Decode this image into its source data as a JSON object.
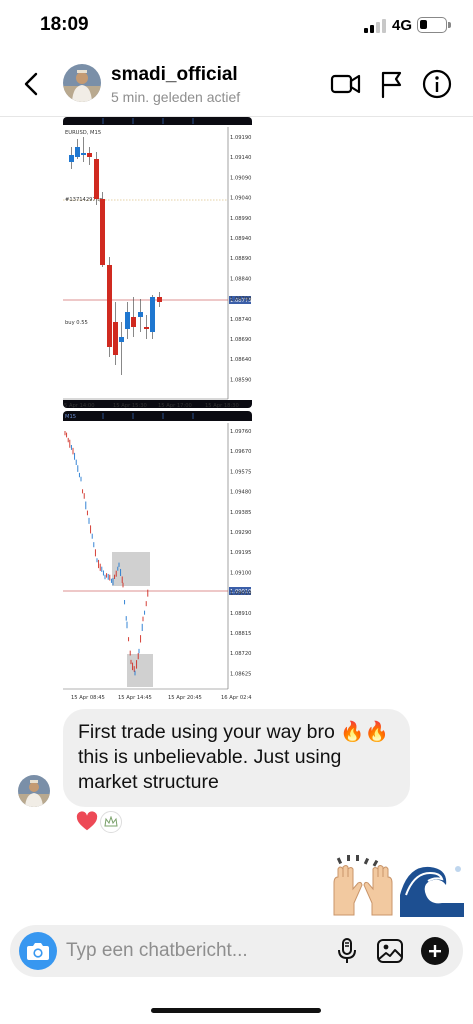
{
  "status_bar": {
    "time": "18:09",
    "network": "4G",
    "battery_level": 0.2
  },
  "header": {
    "username": "smadi_official",
    "activity": "5 min. geleden actief",
    "icons": [
      "back-chevron-icon",
      "video-call-icon",
      "flag-icon",
      "info-icon"
    ]
  },
  "chart1": {
    "symbol": "EURUSD, M15",
    "order_label": "#13714297 tp",
    "buy_label": "buy 0.55",
    "price_ticks": [
      "1.09190",
      "1.09140",
      "1.09090",
      "1.09040",
      "1.08990",
      "1.08940",
      "1.08890",
      "1.08840",
      "1.08790",
      "1.08740",
      "1.08690",
      "1.08640",
      "1.08590"
    ],
    "current_price": "1.08773",
    "time_ticks": [
      "5 Apr 14:00",
      "15 Apr 15:30",
      "15 Apr 17:00",
      "15 Apr 18:30"
    ]
  },
  "chart2": {
    "symbol": "M15",
    "price_ticks": [
      "1.09760",
      "1.09670",
      "1.09575",
      "1.09480",
      "1.09385",
      "1.09290",
      "1.09195",
      "1.09100",
      "1.09010",
      "1.08910",
      "1.08815",
      "1.08720",
      "1.08625"
    ],
    "current_price": "1.09010",
    "time_ticks": [
      "15 Apr 08:45",
      "15 Apr 14:45",
      "15 Apr 20:45",
      "16 Apr 02:4"
    ]
  },
  "message": {
    "text": "First trade using your way bro 🔥🔥 this is unbelievable. Just using market structure"
  },
  "reactions": {
    "heart_icon": "heart-icon",
    "second": "crown-icon"
  },
  "sent": {
    "emoji": "🙌🌊"
  },
  "composer": {
    "placeholder": "Typ een chatbericht..."
  },
  "colors": {
    "accent": "#3797f0",
    "bull": "#1f77d0",
    "bear": "#d02a20",
    "heart": "#ed4956"
  }
}
